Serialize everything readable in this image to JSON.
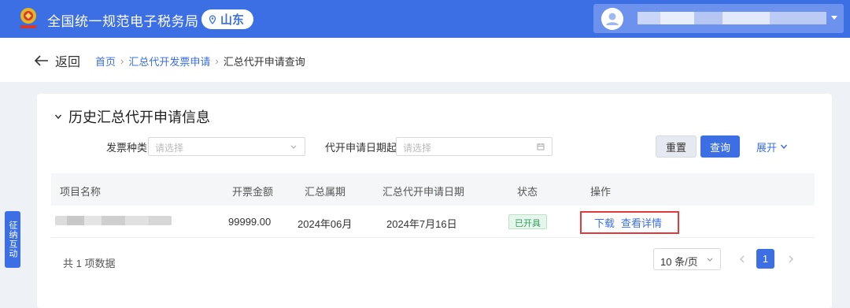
{
  "header": {
    "title": "全国统一规范电子税务局",
    "region": "山东",
    "emblem_icon": "tax-emblem-icon",
    "user_icon": "user-avatar-icon",
    "accent": "#3b6fe3"
  },
  "breadcrumb": {
    "back_label": "返回",
    "items": [
      {
        "label": "首页"
      },
      {
        "label": "汇总代开发票申请"
      },
      {
        "label": "汇总代开申请查询"
      }
    ],
    "separator": "›"
  },
  "section": {
    "title": "历史汇总代开申请信息"
  },
  "filters": {
    "invoice_type_label": "发票种类",
    "invoice_type_placeholder": "请选择",
    "date_from_label": "代开申请日期起",
    "date_from_placeholder": "请选择",
    "reset_label": "重置",
    "query_label": "查询",
    "expand_label": "展开"
  },
  "table": {
    "headers": [
      "项目名称",
      "开票金额",
      "汇总属期",
      "汇总代开申请日期",
      "状态",
      "操作"
    ],
    "rows": [
      {
        "amount": "99999.00",
        "period": "2024年06月",
        "apply_date": "2024年7月16日",
        "status": "已开具",
        "status_color": "#2ea05a",
        "actions": [
          "下载",
          "查看详情"
        ]
      }
    ]
  },
  "pagination": {
    "total_text": "共 1 项数据",
    "page_size": "10 条/页",
    "current_page": "1"
  },
  "side_widget": {
    "label": "征纳互动"
  }
}
